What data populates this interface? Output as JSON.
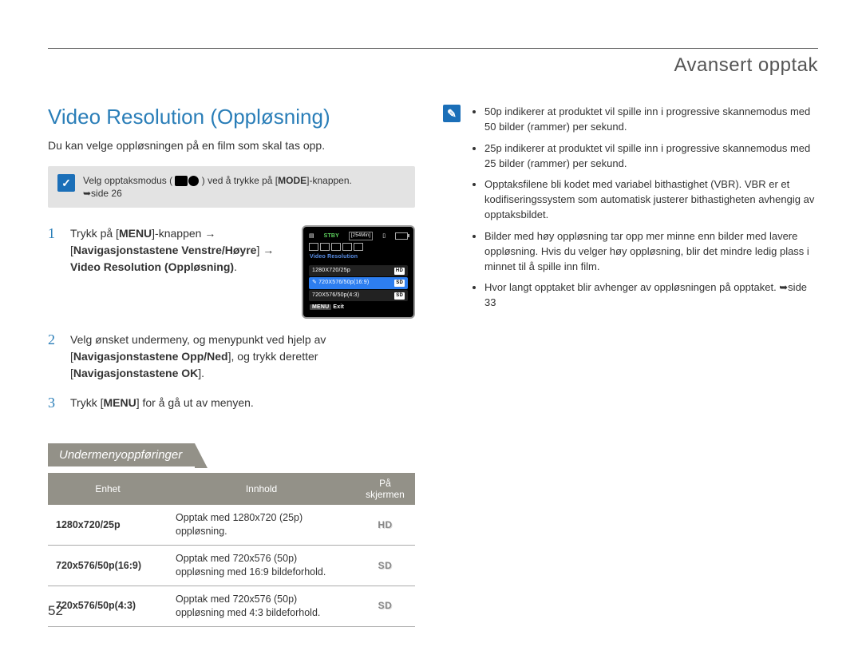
{
  "chapter_title": "Avansert opptak",
  "section_title": "Video Resolution (Oppløsning)",
  "intro": "Du kan velge oppløsningen på en film som skal tas opp.",
  "mode_note": {
    "pre": "Velg opptaksmodus (",
    "post": ") ved å trykke på [",
    "bold": "MODE",
    "post2": "]-knappen.",
    "ref": "➥side 26"
  },
  "steps": [
    {
      "num": "1",
      "parts": {
        "t1": "Trykk på [",
        "b1": "MENU",
        "t2": "]-knappen ",
        "arrow1": "→",
        "t3": " [",
        "b2": "Navigasjonstastene Venstre/Høyre",
        "t4": "] ",
        "arrow2": "→",
        "t5": " ",
        "b3": "Video Resolution (Oppløsning)",
        "t6": "."
      }
    },
    {
      "num": "2",
      "parts": {
        "t1": "Velg ønsket undermeny, og menypunkt ved hjelp av [",
        "b1": "Navigasjonstastene Opp/Ned",
        "t2": "], og trykk deretter [",
        "b2": "Navigasjonstastene OK",
        "t3": "]."
      }
    },
    {
      "num": "3",
      "parts": {
        "t1": "Trykk [",
        "b1": "MENU",
        "t2": "] for å gå ut av menyen."
      }
    }
  ],
  "lcd": {
    "stby": "STBY",
    "time": "[254Min]",
    "menu_title": "Video Resolution",
    "items": [
      {
        "label": "1280X720/25p",
        "tag": "HD",
        "selected": false
      },
      {
        "label": "720X576/50p(16:9)",
        "tag": "SD",
        "selected": true,
        "pen": "✎"
      },
      {
        "label": "720X576/50p(4:3)",
        "tag": "SD",
        "selected": false
      }
    ],
    "exit_label": "MENU",
    "exit_text": "Exit"
  },
  "submenu_header": "Undermenyoppføringer",
  "table": {
    "head": {
      "unit": "Enhet",
      "content": "Innhold",
      "onscreen": "På skjermen"
    },
    "rows": [
      {
        "unit": "1280x720/25p",
        "content": "Opptak med 1280x720 (25p) oppløsning.",
        "icon": "HD"
      },
      {
        "unit": "720x576/50p(16:9)",
        "content": "Opptak med 720x576 (50p) oppløsning med 16:9 bildeforhold.",
        "icon": "SD"
      },
      {
        "unit": "720x576/50p(4:3)",
        "content": "Opptak med 720x576 (50p) oppløsning med 4:3 bildeforhold.",
        "icon": "SD"
      }
    ]
  },
  "right_bullets": [
    "50p indikerer at produktet vil spille inn i progressive skannemodus med 50 bilder (rammer) per sekund.",
    "25p indikerer at produktet vil spille inn i progressive skannemodus med 25 bilder (rammer) per sekund.",
    "Opptaksfilene bli kodet med variabel bithastighet (VBR). VBR er et kodifiseringssystem som automatisk justerer bithastigheten avhengig av opptaksbildet.",
    "Bilder med høy oppløsning tar opp mer minne enn bilder med lavere oppløsning. Hvis du velger høy oppløsning, blir det mindre ledig plass i minnet til å spille inn film.",
    "Hvor langt opptaket blir avhenger av oppløsningen på opptaket. ➥side 33"
  ],
  "page_number": "52"
}
